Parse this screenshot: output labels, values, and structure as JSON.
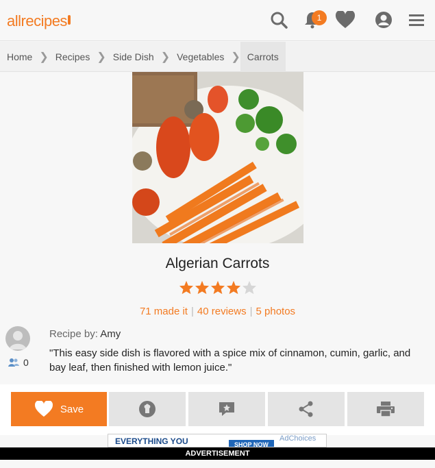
{
  "header": {
    "logo_text": "allrecipes",
    "notification_count": "1",
    "accent_color": "#f37b22"
  },
  "breadcrumb": [
    "Home",
    "Recipes",
    "Side Dish",
    "Vegetables",
    "Carrots"
  ],
  "recipe": {
    "title": "Algerian Carrots",
    "rating": 4,
    "rating_max": 5,
    "made_it": "71 made it",
    "reviews": "40 reviews",
    "photos": "5 photos",
    "author_label": "Recipe by:",
    "author_name": "Amy",
    "follower_count": "0",
    "description": "\"This easy side dish is flavored with a spice mix of cinnamon, cumin, garlic, and bay leaf, then finished with lemon juice.\""
  },
  "actions": {
    "save_label": "Save"
  },
  "ad": {
    "headline": "EVERYTHING YOU",
    "cta": "SHOP NOW",
    "choices": "AdChoices",
    "label": "ADVERTISEMENT"
  }
}
